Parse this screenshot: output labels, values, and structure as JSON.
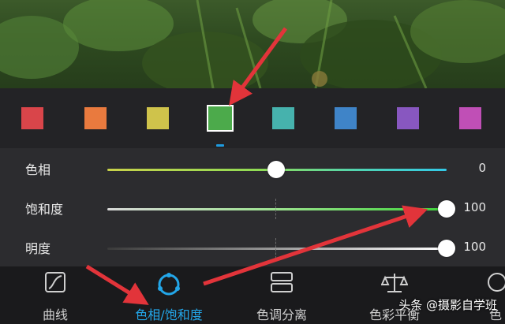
{
  "swatches": [
    {
      "name": "red",
      "color": "#d9454a"
    },
    {
      "name": "orange",
      "color": "#e97a3e"
    },
    {
      "name": "yellow",
      "color": "#cfc34b"
    },
    {
      "name": "green",
      "color": "#4caa4b",
      "selected": true
    },
    {
      "name": "aqua",
      "color": "#46b2ad"
    },
    {
      "name": "blue",
      "color": "#3f84c8"
    },
    {
      "name": "purple",
      "color": "#8857c0"
    },
    {
      "name": "magenta",
      "color": "#c04fb6"
    }
  ],
  "sliders": [
    {
      "label": "色相",
      "value": "0",
      "level": 0.5
    },
    {
      "label": "饱和度",
      "value": "100",
      "level": 1.0
    },
    {
      "label": "明度",
      "value": "100",
      "level": 1.0
    }
  ],
  "toolbar": {
    "curves": "曲线",
    "hsl": "色相/饱和度",
    "tone_split": "色调分离",
    "color_balance": "色彩平衡",
    "partial": "色"
  },
  "watermark": "头条 @摄影自学班",
  "colors": {
    "accent": "#23a6e8",
    "annotation_arrow": "#e2343a"
  }
}
